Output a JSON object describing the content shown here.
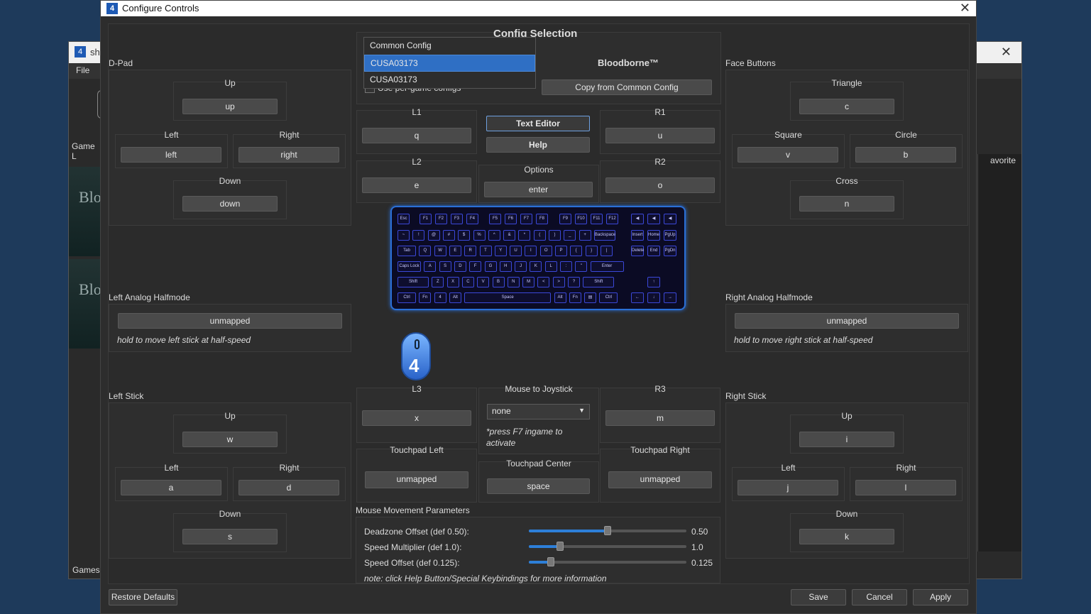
{
  "bg_window": {
    "title": "sha",
    "menu_file": "File",
    "game_list": "Game L",
    "thumb_text": "Blo",
    "games_label": "Games:",
    "favorite_col": "avorite"
  },
  "dialog": {
    "title": "Configure Controls"
  },
  "config_selection": {
    "title": "Config Selection",
    "options": [
      "Common Config",
      "CUSA03173",
      "CUSA03173"
    ],
    "per_game_label": "Use per-game configs",
    "game_name": "Bloodborne™",
    "copy_button": "Copy from Common Config"
  },
  "dpad": {
    "title": "D-Pad",
    "up_label": "Up",
    "up": "up",
    "left_label": "Left",
    "left": "left",
    "right_label": "Right",
    "right": "right",
    "down_label": "Down",
    "down": "down"
  },
  "face": {
    "title": "Face Buttons",
    "triangle_label": "Triangle",
    "triangle": "c",
    "square_label": "Square",
    "square": "v",
    "circle_label": "Circle",
    "circle": "b",
    "cross_label": "Cross",
    "cross": "n"
  },
  "shoulders": {
    "l1_label": "L1",
    "l1": "q",
    "l2_label": "L2",
    "l2": "e",
    "r1_label": "R1",
    "r1": "u",
    "r2_label": "R2",
    "r2": "o"
  },
  "center": {
    "text_editor": "Text Editor",
    "help": "Help",
    "options_label": "Options",
    "options": "enter"
  },
  "left_half": {
    "title": "Left Analog Halfmode",
    "value": "unmapped",
    "note": "hold to move left stick at half-speed"
  },
  "right_half": {
    "title": "Right Analog Halfmode",
    "value": "unmapped",
    "note": "hold to move right stick at half-speed"
  },
  "left_stick": {
    "title": "Left Stick",
    "up_label": "Up",
    "up": "w",
    "left_label": "Left",
    "left": "a",
    "right_label": "Right",
    "right": "d",
    "down_label": "Down",
    "down": "s"
  },
  "right_stick": {
    "title": "Right Stick",
    "up_label": "Up",
    "up": "i",
    "left_label": "Left",
    "left": "j",
    "right_label": "Right",
    "right": "l",
    "down_label": "Down",
    "down": "k"
  },
  "l3": {
    "label": "L3",
    "value": "x"
  },
  "r3": {
    "label": "R3",
    "value": "m"
  },
  "mouse_joy": {
    "label": "Mouse to Joystick",
    "value": "none",
    "note": "*press F7 ingame to activate"
  },
  "touchpad": {
    "left_label": "Touchpad Left",
    "left": "unmapped",
    "center_label": "Touchpad Center",
    "center": "space",
    "right_label": "Touchpad Right",
    "right": "unmapped"
  },
  "mouse_params": {
    "title": "Mouse Movement Parameters",
    "deadzone_label": "Deadzone Offset (def 0.50):",
    "deadzone": "0.50",
    "deadzone_level": 0.5,
    "speed_label": "Speed Multiplier (def 1.0):",
    "speed": "1.0",
    "speed_level": 0.2,
    "offset_label": "Speed Offset (def 0.125):",
    "offset": "0.125",
    "offset_level": 0.14,
    "note": "note: click Help Button/Special Keybindings for more information"
  },
  "footer": {
    "restore": "Restore Defaults",
    "save": "Save",
    "cancel": "Cancel",
    "apply": "Apply"
  },
  "keyboard": {
    "row1": [
      "Esc",
      "F1",
      "F2",
      "F3",
      "F4",
      "F5",
      "F6",
      "F7",
      "F8",
      "F9",
      "F10",
      "F11",
      "F12"
    ],
    "row2": [
      "~",
      "!",
      "@",
      "#",
      "$",
      "%",
      "^",
      "&",
      "*",
      "(",
      ")",
      "_",
      "+",
      "Backspace"
    ],
    "row3": [
      "Tab",
      "Q",
      "W",
      "E",
      "R",
      "T",
      "Y",
      "U",
      "I",
      "O",
      "P",
      "{",
      "}",
      "|"
    ],
    "row4": [
      "Caps Lock",
      "A",
      "S",
      "D",
      "F",
      "G",
      "H",
      "J",
      "K",
      "L",
      ":",
      "\"",
      "Enter"
    ],
    "row5": [
      "Shift",
      "Z",
      "X",
      "C",
      "V",
      "B",
      "N",
      "M",
      "<",
      ">",
      "?",
      "Shift"
    ],
    "row6": [
      "Ctrl",
      "Fn",
      "4",
      "Alt",
      "Space",
      "Alt",
      "Fn",
      "▤",
      "Ctrl"
    ],
    "nav1": [
      "◀",
      "◀",
      "◀"
    ],
    "nav2": [
      "Insert",
      "Home",
      "PgUp"
    ],
    "nav3": [
      "Delete",
      "End",
      "PgDn"
    ],
    "arrows": [
      "↑",
      "←",
      "↓",
      "→"
    ]
  }
}
